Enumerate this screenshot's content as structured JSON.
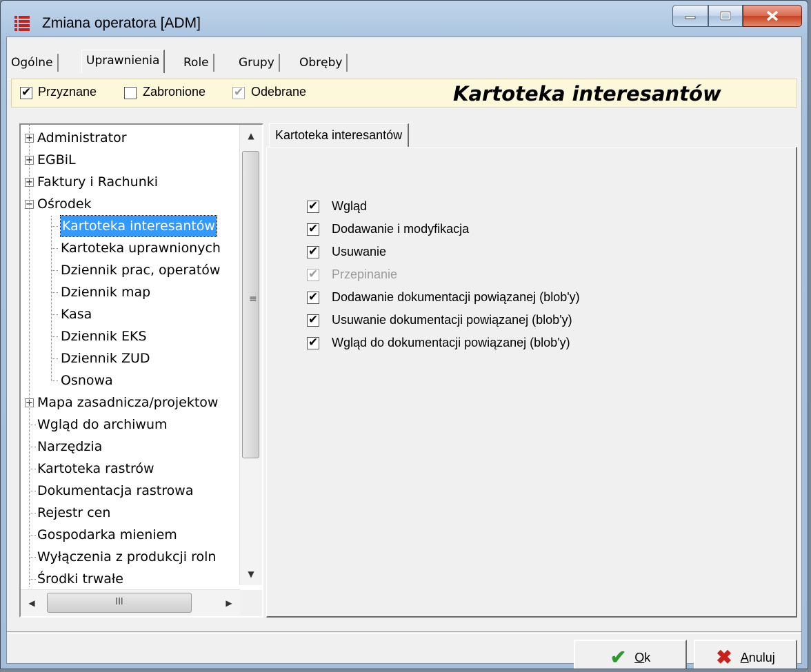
{
  "window": {
    "title": "Zmiana operatora [ADM]",
    "icon": "app-grid-icon"
  },
  "tabs": [
    {
      "label": "Ogólne",
      "active": false
    },
    {
      "label": "Uprawnienia",
      "active": true
    },
    {
      "label": "Role",
      "active": false
    },
    {
      "label": "Grupy",
      "active": false
    },
    {
      "label": "Obręby",
      "active": false
    }
  ],
  "filters": {
    "granted": {
      "label": "Przyznane",
      "checked": true
    },
    "forbidden": {
      "label": "Zabronione",
      "checked": false
    },
    "revoked": {
      "label": "Odebrane",
      "checked": true,
      "greyed": true
    }
  },
  "section_title": "Kartoteka interesantów",
  "tree": [
    {
      "label": "Administrator",
      "expander": "+"
    },
    {
      "label": "EGBiL",
      "expander": "+"
    },
    {
      "label": "Faktury i Rachunki",
      "expander": "+"
    },
    {
      "label": "Ośrodek",
      "expander": "-"
    },
    {
      "label": "Kartoteka interesantów",
      "child": true,
      "selected": true
    },
    {
      "label": "Kartoteka uprawnionych",
      "child": true
    },
    {
      "label": "Dziennik prac, operatów",
      "child": true
    },
    {
      "label": "Dziennik map",
      "child": true
    },
    {
      "label": "Kasa",
      "child": true
    },
    {
      "label": "Dziennik EKS",
      "child": true
    },
    {
      "label": "Dziennik ZUD",
      "child": true
    },
    {
      "label": "Osnowa",
      "child": true
    },
    {
      "label": "Mapa zasadnicza/projektow",
      "expander": "+"
    },
    {
      "label": "Wgląd do archiwum"
    },
    {
      "label": "Narzędzia"
    },
    {
      "label": "Kartoteka rastrów"
    },
    {
      "label": "Dokumentacja rastrowa"
    },
    {
      "label": "Rejestr cen"
    },
    {
      "label": "Gospodarka mieniem"
    },
    {
      "label": "Wyłączenia z produkcji roln"
    },
    {
      "label": "Środki trwałe"
    }
  ],
  "scrollbar": {
    "grip": "≡",
    "h_grip": "III"
  },
  "inner_tab": "Kartoteka interesantów",
  "permissions": [
    {
      "label": "Wgląd",
      "checked": true,
      "disabled": false
    },
    {
      "label": "Dodawanie i modyfikacja",
      "checked": true,
      "disabled": false
    },
    {
      "label": "Usuwanie",
      "checked": true,
      "disabled": false
    },
    {
      "label": "Przepinanie",
      "checked": true,
      "disabled": true
    },
    {
      "label": "Dodawanie dokumentacji powiązanej (blob'y)",
      "checked": true,
      "disabled": false
    },
    {
      "label": "Usuwanie dokumentacji powiązanej (blob'y)",
      "checked": true,
      "disabled": false
    },
    {
      "label": "Wgląd do dokumentacji powiązanej (blob'y)",
      "checked": true,
      "disabled": false
    }
  ],
  "buttons": {
    "ok": {
      "mnemonic": "O",
      "rest": "k",
      "icon": "checkmark-icon",
      "color": "#2e9a2e"
    },
    "cancel": {
      "mnemonic": "A",
      "rest": "nuluj",
      "icon": "x-icon",
      "color": "#c8201a"
    }
  }
}
